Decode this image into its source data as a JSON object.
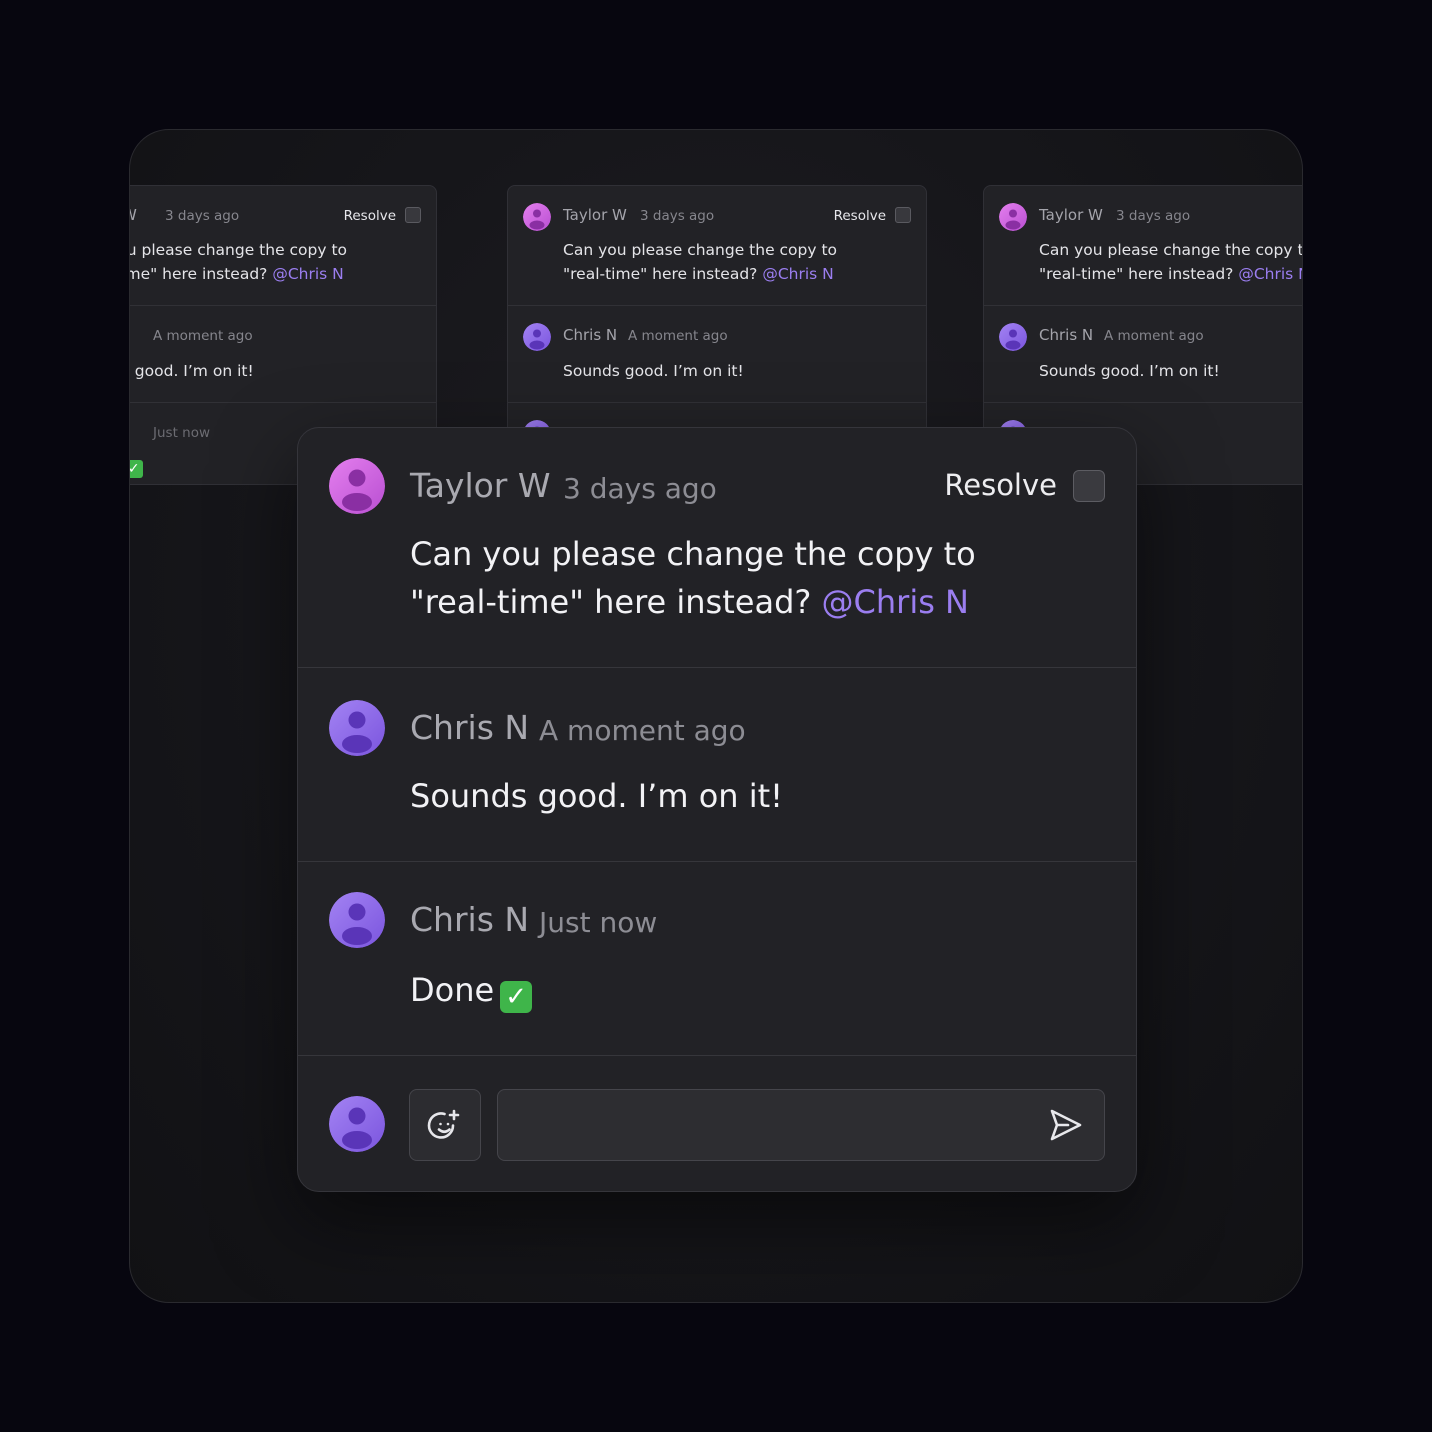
{
  "thread": {
    "comments": [
      {
        "author": "Taylor W",
        "time": "3 days ago",
        "text": "Can you please change the copy to",
        "text_line2": "\"real-time\" here instead?",
        "mention": "@Chris N",
        "avatar_icon": "user-avatar-pink-icon"
      },
      {
        "author": "Chris N",
        "time": "A moment ago",
        "text": "Sounds good. I’m on it!",
        "avatar_icon": "user-avatar-purple-icon"
      },
      {
        "author": "Chris N",
        "time": "Just now",
        "text": "Done",
        "emoji": "✓",
        "avatar_icon": "user-avatar-purple-icon"
      }
    ],
    "resolve_label": "Resolve",
    "resolved": false
  },
  "composer": {
    "input_value": "",
    "placeholder": "",
    "emoji_button_icon": "add-emoji-icon",
    "send_button_icon": "send-icon"
  },
  "colors": {
    "background": "#07060f",
    "card": "#222226",
    "mention": "#9b7ef0",
    "avatar_pink": "#d46be0",
    "avatar_purple": "#8b66e8",
    "done_badge": "#3fb54a"
  }
}
